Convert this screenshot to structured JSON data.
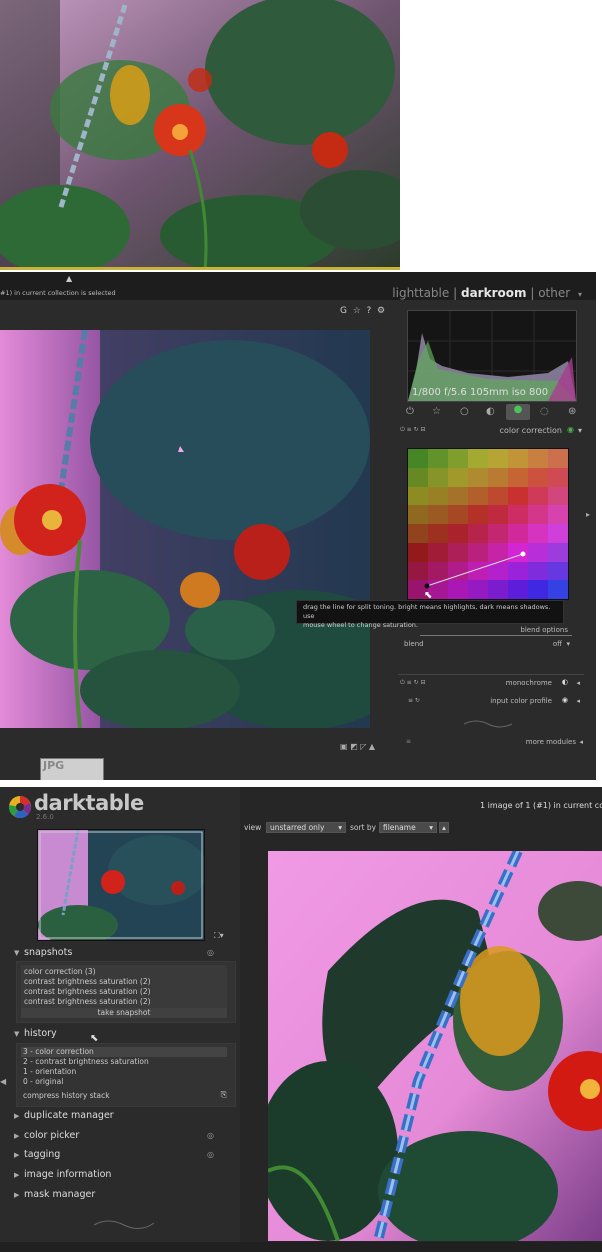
{
  "app": {
    "name": "darktable",
    "version": "2.6.0"
  },
  "views": {
    "lighttable": "lighttable",
    "sep1": "|",
    "darkroom": "darkroom",
    "sep2": "|",
    "other": "other"
  },
  "top_left_status": "#1) in current collection is selected",
  "top_right_status": "1 image of 1 (#1) in current coll",
  "image_toolbar_icons": [
    "G",
    "☆",
    "?",
    "⚙"
  ],
  "histogram": {
    "exif": "1/800 f/5.6 105mm iso 800"
  },
  "module_group_icons": [
    "power-icon",
    "star-icon",
    "circle-icon",
    "tone-icon",
    "color-icon",
    "correct-icon",
    "effect-icon"
  ],
  "color_correction": {
    "title": "color correction"
  },
  "tooltip": {
    "line1": "drag the line for split toning. bright means highlights, dark means shadows. use",
    "line2": "mouse wheel to change saturation."
  },
  "blend": {
    "options": "blend options",
    "label": "blend",
    "value": "off"
  },
  "modules": {
    "monochrome": "monochrome",
    "input_color_profile": "input color profile",
    "more_modules": "more modules"
  },
  "filmstrip": {
    "badge": "JPG"
  },
  "toolbar": {
    "view_label": "view",
    "view_value": "unstarred only",
    "sort_label": "sort by",
    "sort_value": "filename"
  },
  "snapshots": {
    "title": "snapshots",
    "items": [
      "color correction (3)",
      "contrast brightness saturation (2)",
      "contrast brightness saturation (2)",
      "contrast brightness saturation (2)"
    ],
    "take": "take snapshot"
  },
  "history": {
    "title": "history",
    "items": [
      "3 - color correction",
      "2 - contrast brightness saturation",
      "1 - orientation",
      "0 - original"
    ],
    "compress": "compress history stack"
  },
  "sections": {
    "duplicate": "duplicate manager",
    "picker": "color picker",
    "tagging": "tagging",
    "info": "image information",
    "mask": "mask manager"
  },
  "colors": {
    "accent": "#e8e8e8",
    "flower_red": "#d31a12",
    "pink_wall": "#e58ad6"
  }
}
